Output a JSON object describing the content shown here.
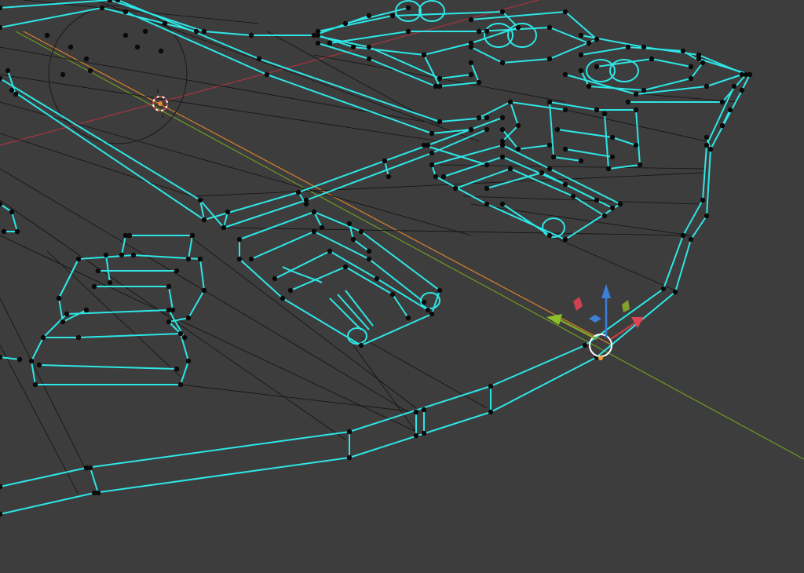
{
  "viewport": {
    "mode": "wireframe",
    "background": "#3d3d3d",
    "colors": {
      "selected_wire": "#2ee6e6",
      "unselected_wire": "#111111",
      "vertex": "#0a0a0a",
      "x_axis": "#c43b48",
      "y_axis": "#7fa62a",
      "z_axis": "#3a7fd8",
      "origin_ray": "#e08a2a",
      "cursor_ring": "#e04040",
      "gizmo_circle": "#ffffff",
      "gizmo_origin": "#f0a030"
    },
    "icons": {
      "cursor": "3d-cursor-icon",
      "gizmo": "transform-gizmo-icon",
      "arrow_x": "x-arrow-icon",
      "arrow_y": "y-arrow-icon",
      "arrow_z": "z-arrow-icon",
      "plane_xy": "xy-plane-handle-icon",
      "plane_xz": "xz-plane-handle-icon",
      "plane_yz": "yz-plane-handle-icon"
    }
  }
}
